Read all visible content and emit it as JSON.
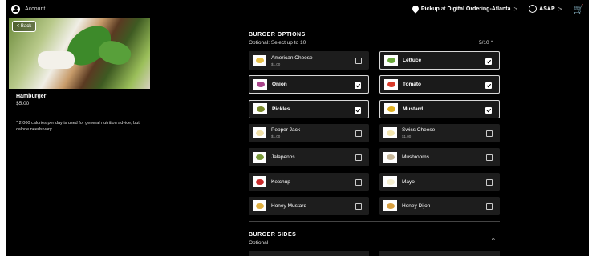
{
  "topbar": {
    "account_label": "Account",
    "pickup_prefix": "Pickup",
    "pickup_at": "at",
    "location": "Digital Ordering-Atlanta",
    "location_chevron": ">",
    "time": "ASAP",
    "time_chevron": ">"
  },
  "hero": {
    "back_label": "< Back"
  },
  "product": {
    "name": "Hamburger",
    "price": "$5.00",
    "note": "* 2,000 calories per day is used for general nutrition advice, but calorie needs vary."
  },
  "options": {
    "title": "BURGER OPTIONS",
    "subtitle": "Optional: Select up to 10",
    "count": "5/10 ^",
    "items": [
      {
        "name": "American Cheese",
        "price": "$1.00",
        "selected": false,
        "color": "#e8c14a"
      },
      {
        "name": "Lettuce",
        "price": "",
        "selected": true,
        "color": "#6aa83a"
      },
      {
        "name": "Onion",
        "price": "",
        "selected": true,
        "color": "#a8448a"
      },
      {
        "name": "Tomato",
        "price": "",
        "selected": true,
        "color": "#d83a2a"
      },
      {
        "name": "Pickles",
        "price": "",
        "selected": true,
        "color": "#7a8a2a"
      },
      {
        "name": "Mustard",
        "price": "",
        "selected": true,
        "color": "#e0b020"
      },
      {
        "name": "Pepper Jack",
        "price": "$1.00",
        "selected": false,
        "color": "#f0e0a8"
      },
      {
        "name": "Swiss Cheese",
        "price": "$1.00",
        "selected": false,
        "color": "#f3e6b0"
      },
      {
        "name": "Jalapenos",
        "price": "",
        "selected": false,
        "color": "#7a9a3a"
      },
      {
        "name": "Mushrooms",
        "price": "",
        "selected": false,
        "color": "#c8b89a"
      },
      {
        "name": "Ketchup",
        "price": "",
        "selected": false,
        "color": "#c82a2a"
      },
      {
        "name": "Mayo",
        "price": "",
        "selected": false,
        "color": "#f5efd0"
      },
      {
        "name": "Honey Mustard",
        "price": "",
        "selected": false,
        "color": "#e0b040"
      },
      {
        "name": "Honey Dijon",
        "price": "",
        "selected": false,
        "color": "#d8a040"
      }
    ]
  },
  "sides": {
    "title": "BURGER SIDES",
    "subtitle": "Optional",
    "chevron": "^"
  }
}
